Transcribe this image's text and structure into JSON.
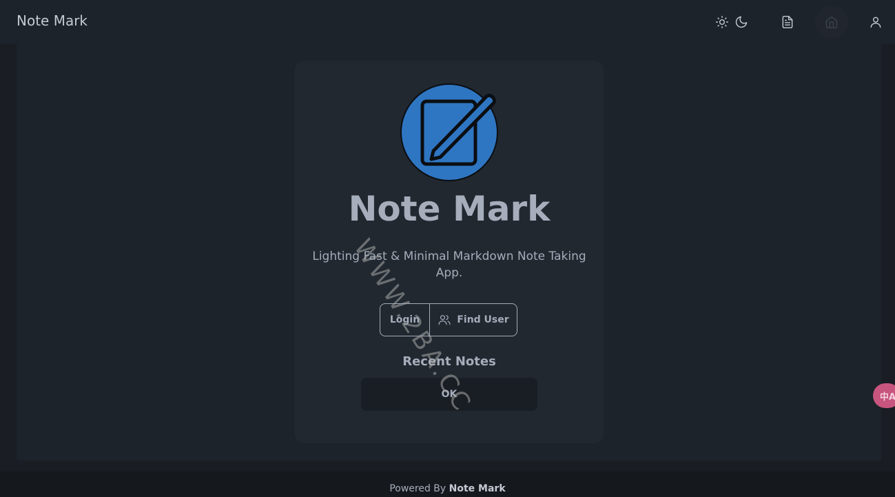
{
  "navbar": {
    "brand": "Note Mark",
    "icons": [
      "sun-icon",
      "moon-icon",
      "document-icon",
      "home-icon",
      "user-icon"
    ]
  },
  "card": {
    "title": "Note Mark",
    "subtitle": "Lighting Fast & Minimal Markdown Note Taking App.",
    "login_label": "Login",
    "find_user_label": "Find User",
    "recent_notes_title": "Recent Notes",
    "notes": [
      "OK"
    ]
  },
  "footer": {
    "prefix": "Powered By",
    "brand": "Note Mark"
  },
  "watermark": "WWW.2BA.CC",
  "translate_widget": "中A",
  "colors": {
    "background": "#1a1d23",
    "navbar": "#1d232a",
    "card": "#212830",
    "logo_blue": "#2f76c2",
    "text": "#a6adbb"
  }
}
